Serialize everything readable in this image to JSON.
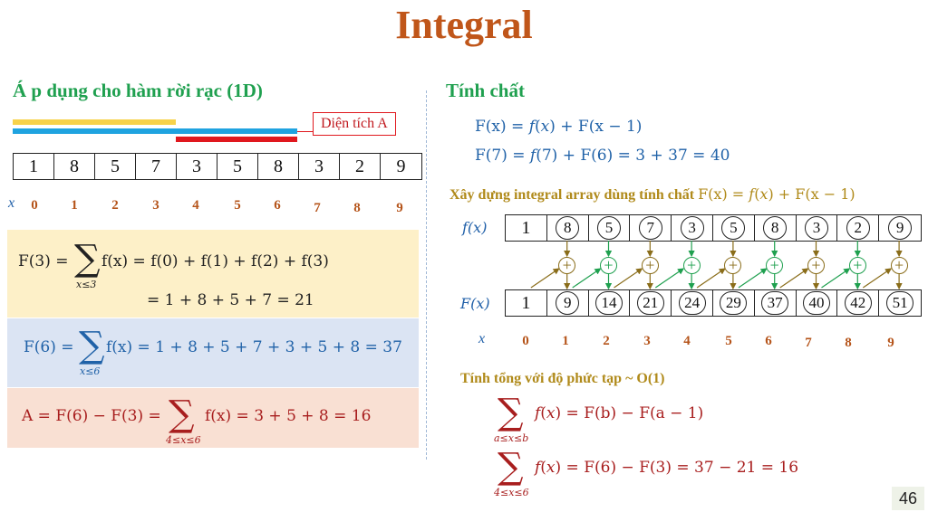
{
  "title": "Integral",
  "left": {
    "heading": "Á p dụng cho hàm rời rạc (1D)",
    "area_label": "Diện tích A",
    "array": [
      "1",
      "8",
      "5",
      "7",
      "3",
      "5",
      "8",
      "3",
      "2",
      "9"
    ],
    "x_label": "x",
    "indices": [
      "0",
      "1",
      "2",
      "3",
      "4",
      "5",
      "6",
      "7",
      "8",
      "9"
    ],
    "f3_lhs": "F(3) = ",
    "f3_sub": "x≤3",
    "f3_rhs1": "f(x)  = f(0) + f(1) + f(2) + f(3)",
    "f3_rhs2": "= 1 + 8 + 5 + 7 = 21",
    "f6_lhs": "F(6) = ",
    "f6_sub": "x≤6",
    "f6_rhs": "f(x)  = 1 + 8 + 5 + 7 + 3 + 5 + 8 = 37",
    "a_lhs": "A = F(6) − F(3) = ",
    "a_sub": "4≤x≤6",
    "a_rhs": "f(x)  = 3 + 5 + 8 = 16",
    "sum_symbol": "∑",
    "colors": {
      "yellow": "#f7d24a",
      "blue": "#1fa3e0",
      "red": "#e0181e",
      "box_yellow": "#fdf0c8",
      "box_blue": "#dbe4f3",
      "box_red": "#f9e0d3"
    }
  },
  "right": {
    "heading": "Tính chất",
    "prop1": "F(x) = 𝑓(𝑥) + F(x − 1)",
    "prop2": "F(7) = 𝑓(7) + F(6) = 3 + 37 = 40",
    "build_text": "Xây dựng integral array dùng tính chất ",
    "build_formula": "F(x) = 𝑓(𝑥) + F(x − 1)",
    "f_label": "𝑓(𝑥)",
    "F_label": "𝐹(𝑥)",
    "f_array": [
      "1",
      "8",
      "5",
      "7",
      "3",
      "5",
      "8",
      "3",
      "2",
      "9"
    ],
    "F_array": [
      "1",
      "9",
      "14",
      "21",
      "24",
      "29",
      "37",
      "40",
      "42",
      "51"
    ],
    "plus": "+",
    "x_label": "x",
    "indices": [
      "0",
      "1",
      "2",
      "3",
      "4",
      "5",
      "6",
      "7",
      "8",
      "9"
    ],
    "complexity": "Tính tổng với độ phức tạp ~ O(1)",
    "sum1_sub": "a≤x≤b",
    "sum1_rhs": "𝑓(𝑥)  = F(b) − F(a − 1)",
    "sum2_sub": "4≤x≤6",
    "sum2_rhs": "𝑓(𝑥)  = F(6) − F(3) = 37 − 21 = 16",
    "sum_symbol": "∑"
  },
  "page_number": "46"
}
